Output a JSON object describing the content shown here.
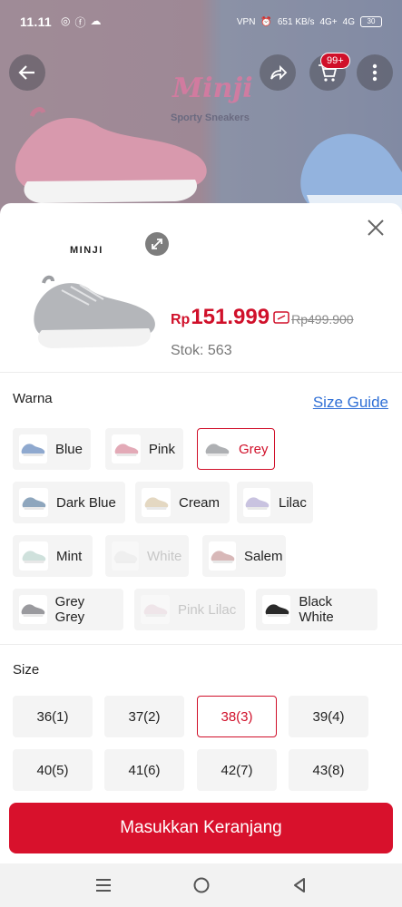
{
  "status_bar": {
    "time": "11.11",
    "indicators": "VPN",
    "speed": "651 KB/s",
    "net1": "4G+",
    "net2": "4G",
    "battery": "30"
  },
  "background": {
    "brand_logo": "Minji",
    "brand_tagline": "Sporty Sneakers",
    "cart_badge": "99+"
  },
  "sheet": {
    "product_brand": "MINJI",
    "price_currency": "Rp",
    "price_value": "151.999",
    "price_original": "Rp499.900",
    "stock": "Stok: 563",
    "color_section_label": "Warna",
    "size_guide_link": "Size Guide",
    "size_section_label": "Size",
    "colors": [
      {
        "label": "Blue",
        "swatch": "#8fa9cf",
        "state": "normal"
      },
      {
        "label": "Pink",
        "swatch": "#e3aab7",
        "state": "normal"
      },
      {
        "label": "Grey",
        "swatch": "#aeb0b3",
        "state": "selected"
      },
      {
        "label": "Dark Blue",
        "swatch": "#8ea6bd",
        "state": "normal"
      },
      {
        "label": "Cream",
        "swatch": "#e4d8c2",
        "state": "normal"
      },
      {
        "label": "Lilac",
        "swatch": "#c9c3e0",
        "state": "normal"
      },
      {
        "label": "Mint",
        "swatch": "#cfe1dc",
        "state": "normal"
      },
      {
        "label": "White",
        "swatch": "#e9e9e9",
        "state": "disabled"
      },
      {
        "label": "Salem",
        "swatch": "#d8b8b8",
        "state": "normal"
      },
      {
        "label": "Grey Grey",
        "swatch": "#9a9a9e",
        "state": "normal"
      },
      {
        "label": "Pink Lilac",
        "swatch": "#ead3dc",
        "state": "disabled"
      },
      {
        "label": "Black White",
        "swatch": "#2a2a2a",
        "state": "normal"
      }
    ],
    "sizes": [
      {
        "label": "36(1)",
        "state": "normal"
      },
      {
        "label": "37(2)",
        "state": "normal"
      },
      {
        "label": "38(3)",
        "state": "selected"
      },
      {
        "label": "39(4)",
        "state": "normal"
      },
      {
        "label": "40(5)",
        "state": "normal"
      },
      {
        "label": "41(6)",
        "state": "normal"
      },
      {
        "label": "42(7)",
        "state": "normal"
      },
      {
        "label": "43(8)",
        "state": "normal"
      }
    ]
  },
  "cta_label": "Masukkan Keranjang",
  "colors": {
    "accent": "#d8112c",
    "link": "#2f6fd6"
  }
}
